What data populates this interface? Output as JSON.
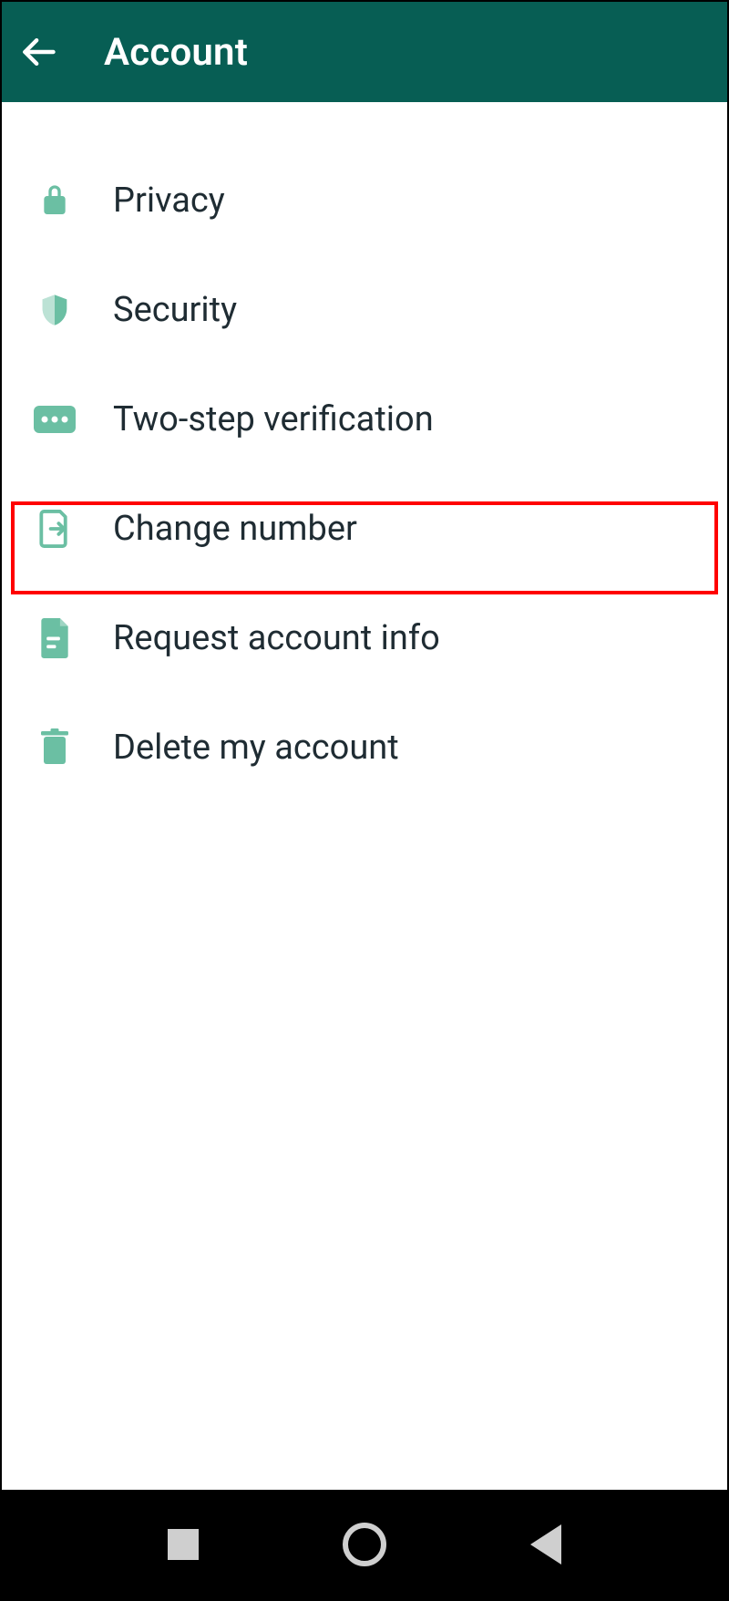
{
  "header": {
    "title": "Account"
  },
  "menu": {
    "items": [
      {
        "label": "Privacy",
        "icon": "lock-icon"
      },
      {
        "label": "Security",
        "icon": "shield-icon"
      },
      {
        "label": "Two-step verification",
        "icon": "pin-icon"
      },
      {
        "label": "Change number",
        "icon": "sim-icon"
      },
      {
        "label": "Request account info",
        "icon": "document-icon"
      },
      {
        "label": "Delete my account",
        "icon": "trash-icon"
      }
    ],
    "highlighted_index": 3
  },
  "colors": {
    "primary": "#075E54",
    "iconTint": "#6BBFA3",
    "text": "#1f2c33",
    "highlight": "#ff0000"
  }
}
